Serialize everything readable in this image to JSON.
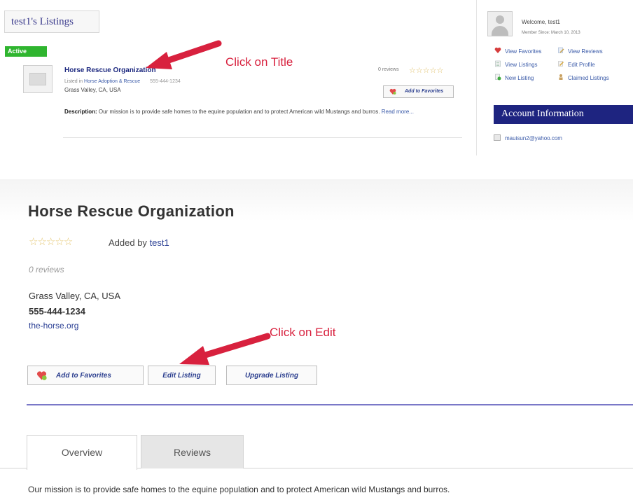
{
  "top": {
    "listings_title": "test1's Listings",
    "status_badge": "Active",
    "listing": {
      "title": "Horse Rescue Organization",
      "listed_in_prefix": "Listed in",
      "category": "Horse Adoption & Rescue",
      "phone": "555-444-1234",
      "address": "Grass Valley, CA, USA",
      "description_label": "Description:",
      "description": "Our mission is to provide safe homes to the equine population and to protect American wild Mustangs and burros.",
      "read_more": "Read more...",
      "reviews": "0 reviews",
      "stars": "☆☆☆☆☆",
      "add_to_favorites": "Add to Favorites"
    },
    "annotation": "Click on Title"
  },
  "sidebar": {
    "welcome": "Welcome, test1",
    "member_since": "Member Since: March 10, 2013",
    "links": [
      {
        "label": "View Favorites",
        "icon": "heart-icon"
      },
      {
        "label": "View Reviews",
        "icon": "review-icon"
      },
      {
        "label": "View Listings",
        "icon": "list-icon"
      },
      {
        "label": "Edit Profile",
        "icon": "pencil-icon"
      },
      {
        "label": "New Listing",
        "icon": "new-listing-icon"
      },
      {
        "label": "Claimed Listings",
        "icon": "claim-icon"
      }
    ],
    "account_header": "Account Information",
    "email": "mauisun2@yahoo.com"
  },
  "detail": {
    "title": "Horse Rescue Organization",
    "stars": "☆☆☆☆☆",
    "added_by_prefix": "Added by",
    "added_by_user": "test1",
    "reviews": "0 reviews",
    "address": "Grass Valley, CA, USA",
    "phone": "555-444-1234",
    "website": "the-horse.org",
    "annotation": "Click on Edit",
    "buttons": {
      "favorites": "Add to Favorites",
      "edit": "Edit Listing",
      "upgrade": "Upgrade Listing"
    },
    "tabs": [
      "Overview",
      "Reviews"
    ],
    "about": "Our mission is to provide safe homes to the equine population and to protect American wild Mustangs and burros."
  },
  "colors": {
    "accent_red": "#d8213e",
    "navy": "#1e2480",
    "active_green": "#2fb52f",
    "link_blue": "#2a3f94"
  }
}
